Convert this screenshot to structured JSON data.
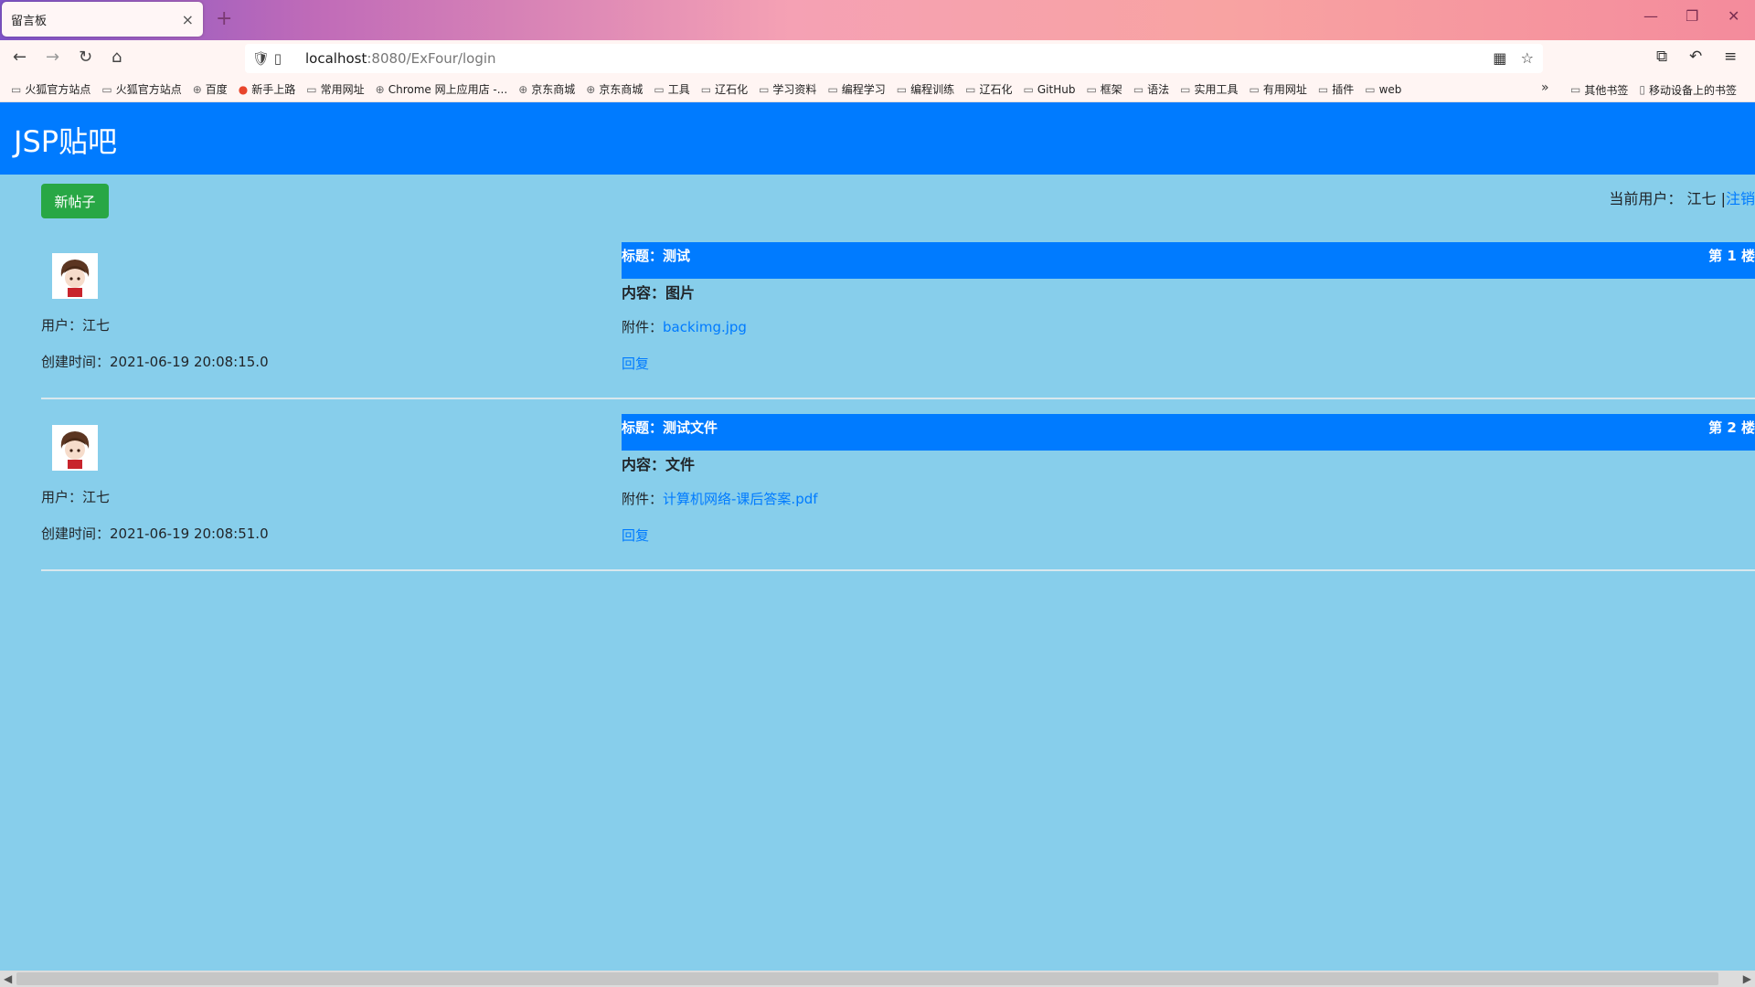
{
  "browser": {
    "tab_title": "留言板",
    "tab_close": "×",
    "new_tab": "+",
    "url_host": "localhost",
    "url_path": ":8080/ExFour/login",
    "bookmarks": [
      "火狐官方站点",
      "火狐官方站点",
      "百度",
      "新手上路",
      "常用网址",
      "Chrome 网上应用店 -...",
      "京东商城",
      "京东商城",
      "工具",
      "辽石化",
      "学习资料",
      "编程学习",
      "编程训练",
      "辽石化",
      "GitHub",
      "框架",
      "语法",
      "实用工具",
      "有用网址",
      "插件",
      "web"
    ],
    "bookmark_other": "其他书签",
    "bookmark_mobile": "移动设备上的书签"
  },
  "site": {
    "title": "JSP贴吧",
    "new_post_label": "新帖子",
    "current_user_label": "当前用户：",
    "current_user": "江七",
    "separator": "|",
    "logout_label": "注销"
  },
  "posts": [
    {
      "user": "用户：江七",
      "created": "创建时间：2021-06-19 20:08:15.0",
      "title": "标题：测试",
      "floor": "第 1 楼",
      "content": "内容：图片",
      "attachment_label": "附件：",
      "attachment_name": "backimg.jpg",
      "reply_label": "回复"
    },
    {
      "user": "用户：江七",
      "created": "创建时间：2021-06-19 20:08:51.0",
      "title": "标题：测试文件",
      "floor": "第 2 楼",
      "content": "内容：文件",
      "attachment_label": "附件：",
      "attachment_name": "计算机网络-课后答案.pdf",
      "reply_label": "回复"
    }
  ],
  "colors": {
    "page_background": "#87ceeb",
    "header_blue": "#007bff",
    "button_green": "#28a745"
  }
}
